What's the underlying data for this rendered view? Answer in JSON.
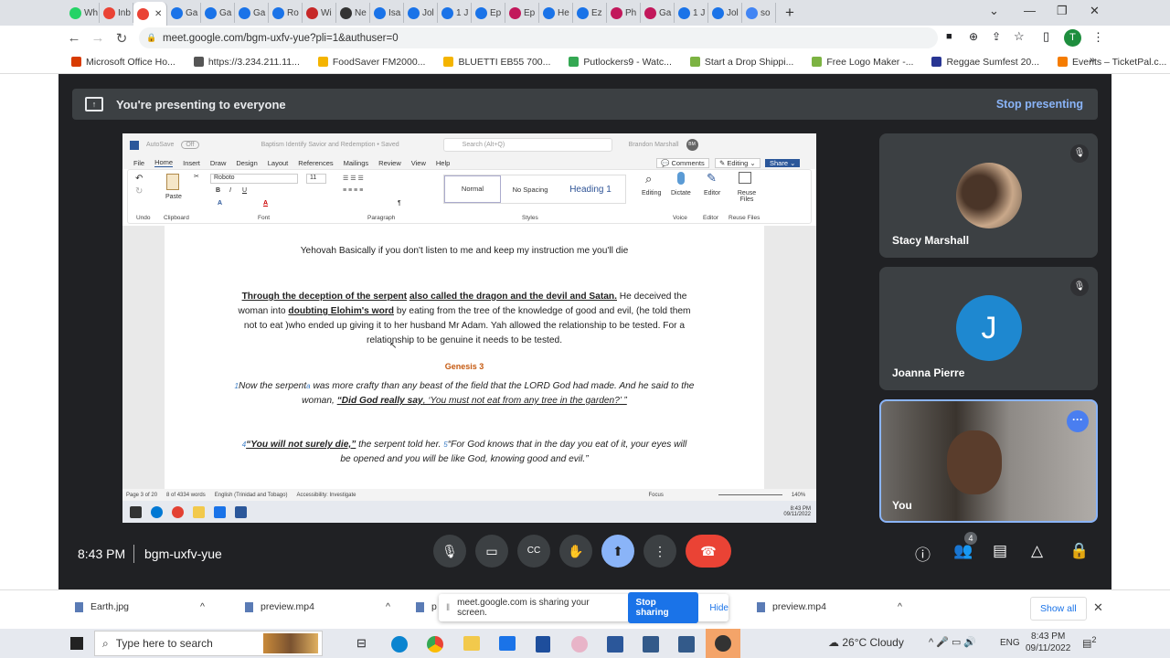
{
  "browser": {
    "tabs": [
      "Wh",
      "Inb",
      "",
      "Ga",
      "Ga",
      "Ga",
      "Ro",
      "Wi",
      "Ne",
      "Isa",
      "Jol",
      "1 J",
      "Ep",
      "Ep",
      "He",
      "Ez",
      "Ph",
      "Ga",
      "1 J",
      "Jol",
      "so"
    ],
    "url": "meet.google.com/bgm-uxfv-yue?pli=1&authuser=0",
    "profile_initial": "T",
    "bookmarks": [
      "Microsoft Office Ho...",
      "https://3.234.211.11...",
      "FoodSaver FM2000...",
      "BLUETTI EB55 700...",
      "Putlockers9 - Watc...",
      "Start a Drop Shippi...",
      "Free Logo Maker -...",
      "Reggae Sumfest 20...",
      "Events – TicketPal.c..."
    ],
    "bookmarks_more": "»"
  },
  "meet": {
    "banner_text": "You're presenting to everyone",
    "stop_presenting": "Stop presenting",
    "time": "8:43 PM",
    "meeting_code": "bgm-uxfv-yue",
    "participant_count": "4",
    "accent": "#8ab4f8",
    "end_call_color": "#ea4335",
    "participants": [
      {
        "name": "Stacy Marshall",
        "muted": true
      },
      {
        "name": "Joanna Pierre",
        "initial": "J",
        "avatar_color": "#1e88d0",
        "muted": true
      },
      {
        "name": "You"
      }
    ]
  },
  "word": {
    "autosave": "AutoSave",
    "autosave_state": "Off",
    "doc_title": "Baptism Identify Savior and Redemption • Saved",
    "search_placeholder": "Search (Alt+Q)",
    "user": "Brandon Marshall",
    "user_initials": "BM",
    "menu": [
      "File",
      "Home",
      "Insert",
      "Draw",
      "Design",
      "Layout",
      "References",
      "Mailings",
      "Review",
      "View",
      "Help"
    ],
    "comments": "Comments",
    "editing": "Editing",
    "share": "Share",
    "font": "Roboto",
    "font_size": "11",
    "paste": "Paste",
    "styles": [
      "Normal",
      "No Spacing",
      "Heading 1"
    ],
    "groups": [
      "Undo",
      "Clipboard",
      "Font",
      "Paragraph",
      "Styles",
      "Voice",
      "Editor",
      "Reuse Files"
    ],
    "right_buttons": [
      "Editing",
      "Dictate",
      "Editor",
      "Reuse Files"
    ],
    "doc": {
      "line1": "Yehovah Basically if you don't listen to me and keep my instruction me you'll die",
      "p2a": "Through the deception of the serpent",
      "p2b": "also called the dragon and the devil and Satan.",
      "p2c": " He deceived the woman into ",
      "p2d": "doubting Elohim's word",
      "p2e": " by eating from the tree of the knowledge of good and evil, (he told them not to eat )who ended up giving it to her husband Mr Adam. Yah allowed the relationship to be tested. For a relationship to be genuine it needs to be tested.",
      "heading": "Genesis 3",
      "v1n": "1",
      "v1a": "Now the serpent",
      "v1fn": "a",
      "v1b": " was more crafty than any beast of the field that the LORD God had made. And he said to the woman, ",
      "v1c": "“Did God really say",
      "v1d": ", ‘You must not eat from any tree in the garden?’ ”",
      "v4n": "4",
      "v4a": "“You will not surely die,”",
      "v4b": " the serpent told her. ",
      "v5n": "5",
      "v5a": "“For God knows that in the day you eat of it, your eyes will be opened and you will be like God, knowing good and evil.”"
    },
    "status": [
      "Page 3 of 20",
      "8 of 4334 words",
      "English (Trinidad and Tobago)",
      "Accessibility: Investigate"
    ],
    "focus": "Focus",
    "zoom": "140%",
    "clock": "8:43 PM",
    "date": "09/11/2022"
  },
  "downloads": {
    "items": [
      "Earth.jpg",
      "preview.mp4",
      "p",
      "preview.mp4"
    ],
    "share_notice": "meet.google.com is sharing your screen.",
    "stop_sharing": "Stop sharing",
    "hide": "Hide",
    "show_all": "Show all"
  },
  "taskbar": {
    "search_placeholder": "Type here to search",
    "weather": "26°C  Cloudy",
    "lang": "ENG",
    "time": "8:43 PM",
    "date": "09/11/2022",
    "notifications": "2"
  }
}
